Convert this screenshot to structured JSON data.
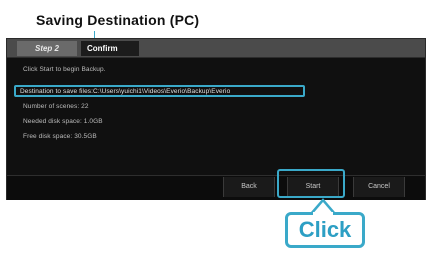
{
  "annotation": {
    "title": "Saving Destination (PC)",
    "click_label": "Click"
  },
  "dialog": {
    "step_label": "Step 2",
    "title": "Confirm",
    "lines": [
      "Click Start to begin Backup.",
      "Destination to save files:C:\\Users\\yuichi1\\Videos\\Everio\\Backup\\Everio",
      "Number of scenes:  22",
      "Needed disk space:  1.0GB",
      "Free disk space:  30.5GB"
    ]
  },
  "footer": {
    "back_label": "Back",
    "start_label": "Start",
    "cancel_label": "Cancel"
  },
  "colors": {
    "accent": "#3aa9c9",
    "dialog_bg": "#101010",
    "header_bg": "#4b4b4b"
  }
}
